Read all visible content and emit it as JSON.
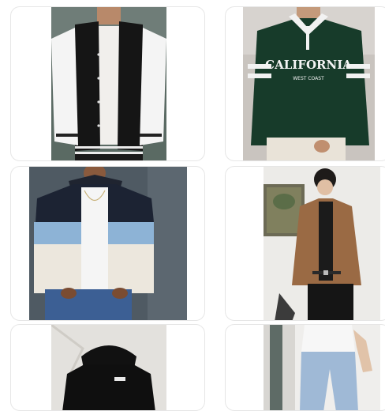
{
  "products": [
    {
      "name": "varsity-jacket-black-white",
      "icon": "product-photo"
    },
    {
      "name": "green-polo-sweatshirt",
      "printed_text": "CALIFORNIA",
      "printed_subtext": "WEST COAST",
      "icon": "product-photo"
    },
    {
      "name": "colorblock-sherpa-hoodie",
      "icon": "product-photo"
    },
    {
      "name": "brown-suede-jacket",
      "icon": "product-photo"
    },
    {
      "name": "black-puffer-jacket",
      "icon": "product-photo"
    },
    {
      "name": "light-wash-jeans",
      "icon": "product-photo"
    }
  ]
}
